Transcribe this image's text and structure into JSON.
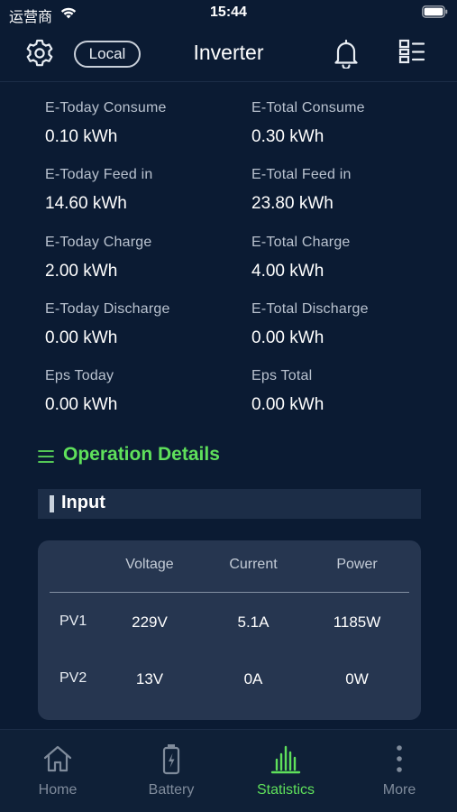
{
  "status_bar": {
    "carrier": "运营商",
    "time": "15:44"
  },
  "header": {
    "mode_label": "Local",
    "title": "Inverter"
  },
  "stats": [
    {
      "label": "E-Today Consume",
      "value": "0.10 kWh"
    },
    {
      "label": "E-Total Consume",
      "value": "0.30 kWh"
    },
    {
      "label": "E-Today Feed in",
      "value": "14.60 kWh"
    },
    {
      "label": "E-Total Feed in",
      "value": "23.80 kWh"
    },
    {
      "label": "E-Today Charge",
      "value": "2.00 kWh"
    },
    {
      "label": "E-Total Charge",
      "value": "4.00 kWh"
    },
    {
      "label": "E-Today Discharge",
      "value": "0.00 kWh"
    },
    {
      "label": "E-Total Discharge",
      "value": "0.00 kWh"
    },
    {
      "label": "Eps Today",
      "value": "0.00 kWh"
    },
    {
      "label": "Eps Total",
      "value": "0.00 kWh"
    }
  ],
  "section": {
    "title": "Operation Details",
    "subheading": "Input"
  },
  "input_table": {
    "columns": [
      "Voltage",
      "Current",
      "Power"
    ],
    "rows": [
      {
        "label": "PV1",
        "cells": [
          "229V",
          "5.1A",
          "1185W"
        ]
      },
      {
        "label": "PV2",
        "cells": [
          "13V",
          "0A",
          "0W"
        ]
      }
    ]
  },
  "tabbar": {
    "items": [
      {
        "label": "Home",
        "icon": "home-icon"
      },
      {
        "label": "Battery",
        "icon": "battery-icon"
      },
      {
        "label": "Statistics",
        "icon": "statistics-icon"
      },
      {
        "label": "More",
        "icon": "more-icon"
      }
    ],
    "active": "Statistics"
  },
  "colors": {
    "background": "#0b1b33",
    "accent": "#5fe05b",
    "card": "#263650"
  }
}
